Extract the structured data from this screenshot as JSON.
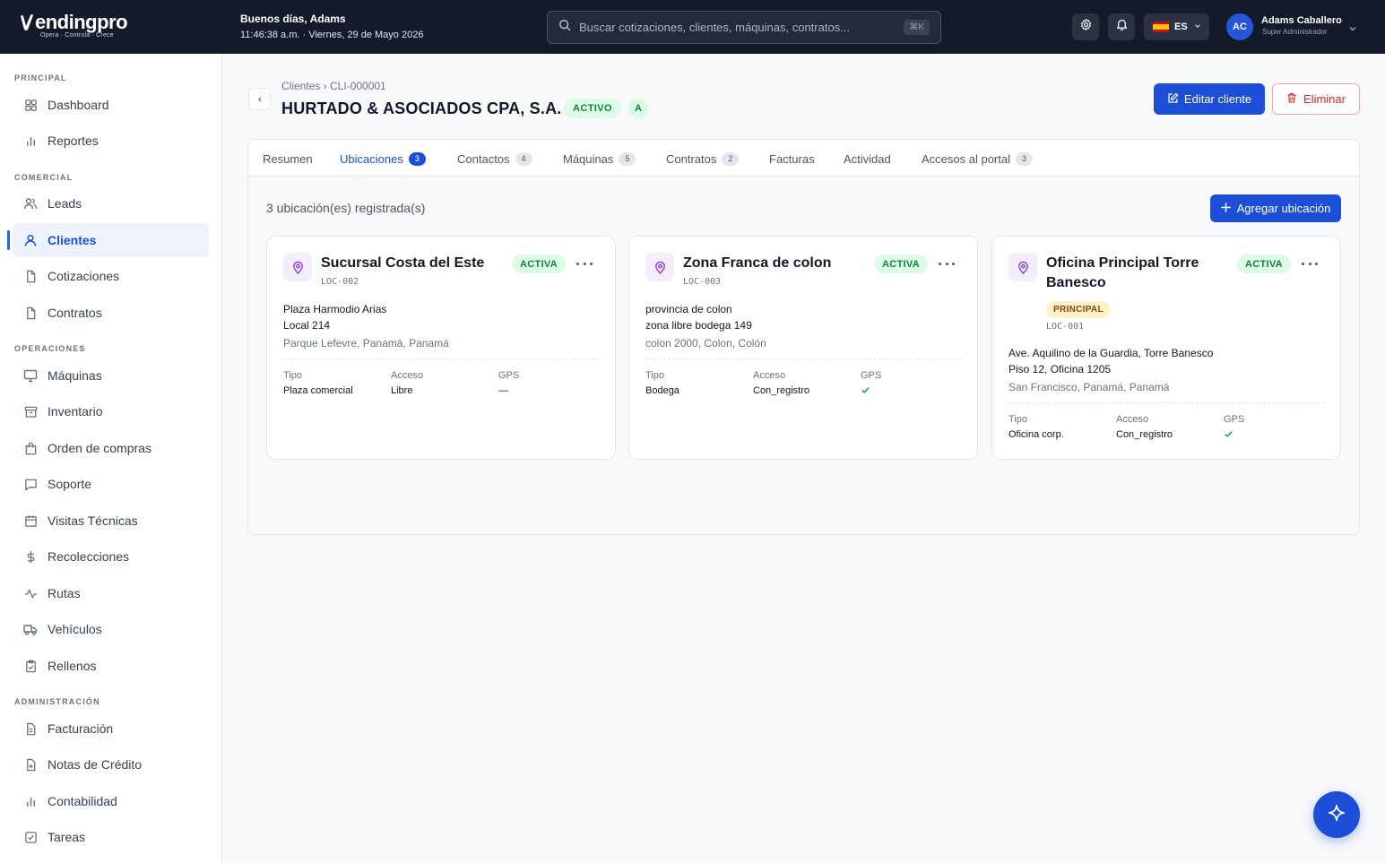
{
  "brand": {
    "name": "endingpro",
    "tagline": "Opera · Controla · Crece"
  },
  "header": {
    "greeting": "Buenos días, Adams",
    "datetime": "11:46:38 a.m. · Viernes, 29 de Mayo 2026",
    "search_placeholder": "Buscar cotizaciones, clientes, máquinas, contratos...",
    "search_shortcut": "⌘K",
    "language": "ES",
    "user": {
      "initials": "AC",
      "name": "Adams Caballero",
      "role": "Super Administrador"
    }
  },
  "sidebar": {
    "sections": {
      "principal": "PRINCIPAL",
      "comercial": "COMERCIAL",
      "operaciones": "OPERACIONES",
      "administracion": "ADMINISTRACIÓN"
    },
    "items": {
      "dashboard": "Dashboard",
      "reportes": "Reportes",
      "leads": "Leads",
      "clientes": "Clientes",
      "cotizaciones": "Cotizaciones",
      "contratos": "Contratos",
      "maquinas": "Máquinas",
      "inventario": "Inventario",
      "orden_compras": "Orden de compras",
      "soporte": "Soporte",
      "visitas": "Visitas Técnicas",
      "recolecciones": "Recolecciones",
      "rutas": "Rutas",
      "vehiculos": "Vehículos",
      "rellenos": "Rellenos",
      "facturacion": "Facturación",
      "notas_credito": "Notas de Crédito",
      "contabilidad": "Contabilidad",
      "tareas": "Tareas"
    }
  },
  "client": {
    "breadcrumb": "Clientes › CLI-000001",
    "name": "HURTADO & ASOCIADOS CPA, S.A.",
    "status": "ACTIVO",
    "grade": "A",
    "edit_label": "Editar cliente",
    "delete_label": "Eliminar"
  },
  "tabs": {
    "resumen": {
      "label": "Resumen"
    },
    "ubicaciones": {
      "label": "Ubicaciones",
      "count": "3"
    },
    "contactos": {
      "label": "Contactos",
      "count": "4"
    },
    "maquinas": {
      "label": "Máquinas",
      "count": "5"
    },
    "contratos": {
      "label": "Contratos",
      "count": "2"
    },
    "facturas": {
      "label": "Facturas"
    },
    "actividad": {
      "label": "Actividad"
    },
    "accesos": {
      "label": "Accesos al portal",
      "count": "3"
    }
  },
  "locations": {
    "count_label": "3 ubicación(es) registrada(s)",
    "add_label": "Agregar ubicación",
    "meta_labels": {
      "tipo": "Tipo",
      "acceso": "Acceso",
      "gps": "GPS"
    },
    "cards": [
      {
        "name": "Sucursal Costa del Este",
        "status": "ACTIVA",
        "code": "LOC-002",
        "address1": "Plaza Harmodio Arias",
        "address2": "Local 214",
        "city": "Parque Lefevre, Panamá, Panamá",
        "tipo": "Plaza comercial",
        "acceso": "Libre",
        "gps": "—"
      },
      {
        "name": "Zona Franca de colon",
        "status": "ACTIVA",
        "code": "LOC-003",
        "address1": "provincia de colon",
        "address2": "zona libre bodega 149",
        "city": "colon 2000, Colon, Colón",
        "tipo": "Bodega",
        "acceso": "Con_registro",
        "gps": "check"
      },
      {
        "name": "Oficina Principal Torre Banesco",
        "status": "ACTIVA",
        "badge": "PRINCIPAL",
        "code": "LOC-001",
        "address1": "Ave. Aquilino de la Guardia, Torre Banesco",
        "address2": "Piso 12, Oficina 1205",
        "city": "San Francisco, Panamá, Panamá",
        "tipo": "Oficina corp.",
        "acceso": "Con_registro",
        "gps": "check"
      }
    ]
  },
  "colors": {
    "primary": "#1d4ed8",
    "topbar": "#121a2c",
    "success_bg": "#dcfce7",
    "success_text": "#15803d",
    "danger": "#dc2626"
  }
}
